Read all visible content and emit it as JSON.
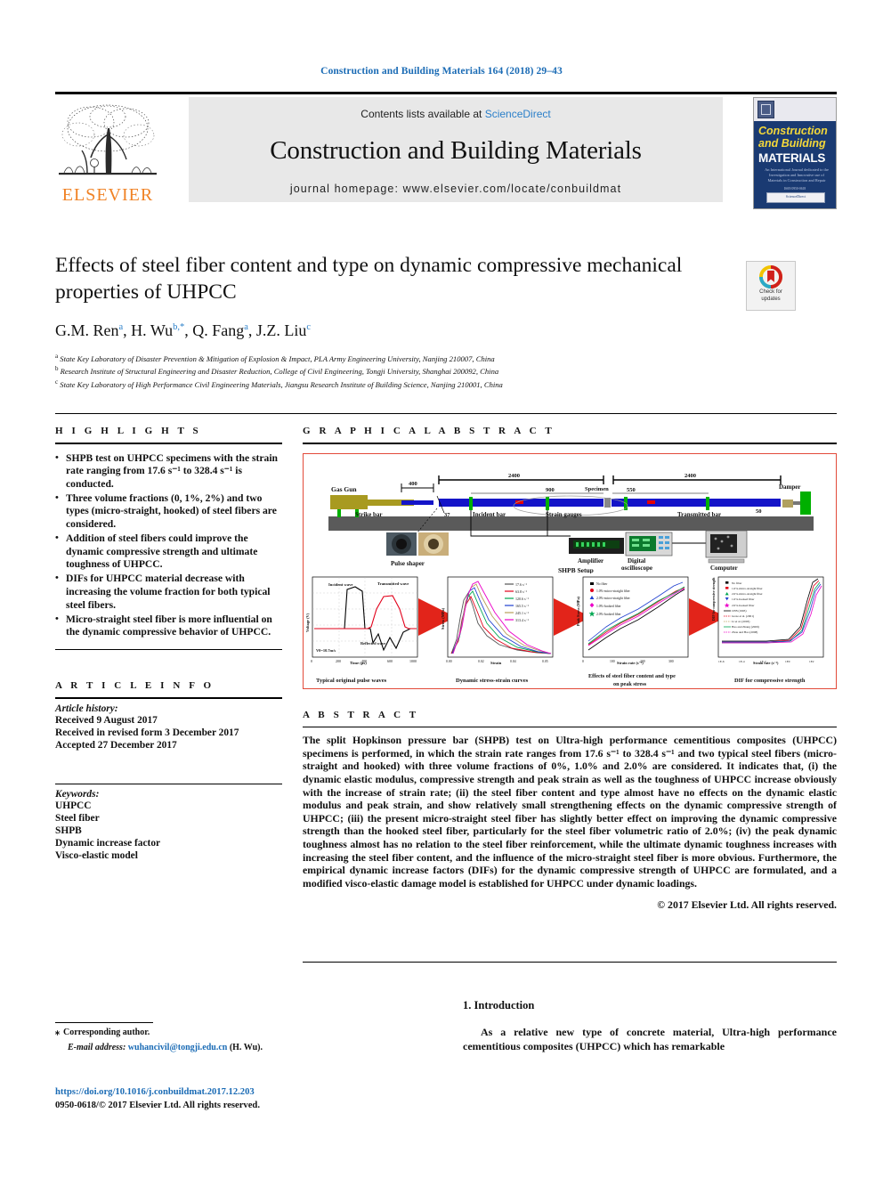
{
  "running_head": "Construction and Building Materials 164 (2018) 29–43",
  "masthead": {
    "contents_prefix": "Contents lists available at ",
    "sciencedirect": "ScienceDirect",
    "journal_title": "Construction and Building Materials",
    "homepage": "journal homepage: www.elsevier.com/locate/conbuildmat",
    "publisher_logo_text": "ELSEVIER",
    "cover": {
      "line1": "Construction",
      "line2": "and Building",
      "line3": "MATERIALS",
      "subtitle": "An International Journal dedicated to the Investigation and Innovative use of Materials in Construction and Repair",
      "footer_badge": "ScienceDirect",
      "issn_note": "ISSN 0950-0618"
    }
  },
  "title_block": {
    "title": "Effects of steel fiber content and type on dynamic compressive mechanical properties of UHPCC",
    "authors": [
      {
        "name": "G.M. Ren",
        "sup": "a"
      },
      {
        "name": "H. Wu",
        "sup": "b,*"
      },
      {
        "name": "Q. Fang",
        "sup": "a"
      },
      {
        "name": "J.Z. Liu",
        "sup": "c"
      }
    ],
    "affiliations": [
      {
        "marker": "a",
        "text": "State Key Laboratory of Disaster Prevention & Mitigation of Explosion & Impact, PLA Army Engineering University, Nanjing 210007, China"
      },
      {
        "marker": "b",
        "text": "Research Institute of Structural Engineering and Disaster Reduction, College of Civil Engineering, Tongji University, Shanghai 200092, China"
      },
      {
        "marker": "c",
        "text": "State Key Laboratory of High Performance Civil Engineering Materials, Jiangsu Research Institute of Building Science, Nanjing 210001, China"
      }
    ],
    "crossmark": {
      "line1": "Check for",
      "line2": "updates"
    }
  },
  "highlights": {
    "heading": "H I G H L I G H T S",
    "items": [
      "SHPB test on UHPCC specimens with the strain rate ranging from 17.6 s⁻¹ to 328.4 s⁻¹ is conducted.",
      "Three volume fractions (0, 1%, 2%) and two types (micro-straight, hooked) of steel fibers are considered.",
      "Addition of steel fibers could improve the dynamic compressive strength and ultimate toughness of UHPCC.",
      "DIFs for UHPCC material decrease with increasing the volume fraction for both typical steel fibers.",
      "Micro-straight steel fiber is more influential on the dynamic compressive behavior of UHPCC."
    ]
  },
  "article_info": {
    "heading": "A R T I C L E   I N F O",
    "history_label": "Article history:",
    "history": [
      "Received 9 August 2017",
      "Received in revised form 3 December 2017",
      "Accepted 27 December 2017"
    ],
    "keywords_label": "Keywords:",
    "keywords": [
      "UHPCC",
      "Steel fiber",
      "SHPB",
      "Dynamic increase factor",
      "Visco-elastic model"
    ]
  },
  "graphical_abstract": {
    "heading": "G R A P H I C A L   A B S T R A C T",
    "setup": {
      "caption": "SHPB Setup",
      "labels": {
        "gas_gun": "Gas Gun",
        "strike_bar": "Strike bar",
        "incident_bar": "Incident bar",
        "strain_gauges": "Strain gauges",
        "transmitted_bar": "Transmitted bar",
        "specimen": "Specimen",
        "damper": "Damper",
        "pulse_shaper": "Pulse shaper",
        "amplifier": "Amplifier",
        "oscilloscope": "Digital oscilloscope",
        "computer": "Computer"
      },
      "dimensions": {
        "strike_bar_len": "400",
        "incident_bar_len": "2400",
        "transmitted_bar_len": "2400",
        "gauge_to_specimen_left": "900",
        "gauge_to_specimen_right": "550",
        "bar_diameter": "37",
        "damper_dim": "50"
      }
    },
    "panels": [
      {
        "caption": "Typical original pulse waves",
        "chart_ref": 0
      },
      {
        "caption": "Dynamic stress-strain curves",
        "chart_ref": 1
      },
      {
        "caption": "Effects of steel fiber content and type on peak stress",
        "chart_ref": 2
      },
      {
        "caption": "DIF for compressive strength",
        "chart_ref": 3
      }
    ]
  },
  "chart_data": [
    {
      "type": "line",
      "title": "Typical original pulse waves",
      "xlabel": "Time (μs)",
      "ylabel": "Voltage (V)",
      "xlim": [
        0,
        1000
      ],
      "ylim": [
        -0.8,
        2.0
      ],
      "xticks": [
        0,
        200,
        400,
        600,
        800,
        1000
      ],
      "yticks": [
        -0.8,
        -0.4,
        0.0,
        0.4,
        0.8,
        1.2,
        1.6,
        2.0
      ],
      "annotation": "V0 = 10.7 m/s",
      "series": [
        {
          "name": "Incident wave",
          "color": "#000000"
        },
        {
          "name": "Transmitted wave",
          "color": "#e2001a"
        },
        {
          "name": "Reflected wave",
          "color": "#000000"
        }
      ]
    },
    {
      "type": "line",
      "title": "Dynamic stress-strain curves",
      "xlabel": "Strain",
      "ylabel": "Stress (MPa)",
      "xlim": [
        0.0,
        0.05
      ],
      "ylim": [
        0,
        250
      ],
      "xticks": [
        0.0,
        0.01,
        0.02,
        0.03,
        0.04,
        0.05
      ],
      "yticks": [
        0,
        50,
        100,
        150,
        200,
        250
      ],
      "legend_position": "top-right",
      "series": [
        {
          "name": "17.6 s⁻¹",
          "color": "#555555"
        },
        {
          "name": "63.8 s⁻¹",
          "color": "#e2001a"
        },
        {
          "name": "120.6 s⁻¹",
          "color": "#00a651"
        },
        {
          "name": "165.5 s⁻¹",
          "color": "#1f3fd0"
        },
        {
          "name": "245.1 s⁻¹",
          "color": "#b8a05a"
        },
        {
          "name": "313.4 s⁻¹",
          "color": "#ec00c8"
        }
      ]
    },
    {
      "type": "scatter",
      "title": "Effects of steel fiber content and type on peak stress",
      "xlabel": "Strain rate (s⁻¹)",
      "ylabel": "Peak Stress (MPa)",
      "xlim": [
        0,
        350
      ],
      "ylim": [
        100,
        280
      ],
      "xticks": [
        0,
        50,
        100,
        150,
        200,
        250,
        300,
        350
      ],
      "yticks": [
        100,
        120,
        140,
        160,
        180,
        200,
        220,
        240,
        260,
        280
      ],
      "legend_position": "top-left",
      "series": [
        {
          "name": "No fiber",
          "color": "#000000",
          "marker": "square"
        },
        {
          "name": "1.0%-micro-straight fiber",
          "color": "#e2001a",
          "marker": "circle"
        },
        {
          "name": "2.0%-micro-straight fiber",
          "color": "#1f3fd0",
          "marker": "triangle"
        },
        {
          "name": "1.0%-hooked fiber",
          "color": "#ec00c8",
          "marker": "diamond"
        },
        {
          "name": "2.0%-hooked fiber",
          "color": "#00a651",
          "marker": "star"
        }
      ]
    },
    {
      "type": "scatter",
      "title": "DIF for compressive strength",
      "xlabel": "Strain rate (s⁻¹)",
      "ylabel": "DIF for compressive strength",
      "xlim": [
        1e-06,
        1000
      ],
      "ylim": [
        0.5,
        2.5
      ],
      "xticks": [
        "1E-6",
        "1E-5",
        "1E-4",
        "1E-3",
        "1E-2",
        "1E-1",
        "1E0",
        "1E1",
        "1E2",
        "1E3"
      ],
      "yticks": [
        0.5,
        1.0,
        1.5,
        2.0,
        2.5
      ],
      "legend_position": "top-left",
      "series": [
        {
          "name": "No fiber",
          "color": "#000000",
          "marker": "square"
        },
        {
          "name": "1.0%-micro-straight fiber",
          "color": "#e2001a",
          "marker": "square"
        },
        {
          "name": "2.0%-micro-straight fiber",
          "color": "#00a651",
          "marker": "triangle"
        },
        {
          "name": "1.0%-hooked fiber",
          "color": "#1f3fd0",
          "marker": "triangle-down"
        },
        {
          "name": "2.0%-hooked fiber",
          "color": "#ec00c8",
          "marker": "star"
        },
        {
          "name": "CEB (1993)",
          "color": "#000000",
          "marker": "line"
        },
        {
          "name": "Grote et al. (2001)",
          "color": "#e2001a",
          "marker": "line"
        },
        {
          "name": "Li et al. (2003)",
          "color": "#b8a05a",
          "marker": "line"
        },
        {
          "name": "Hao and Zhang (2009)",
          "color": "#00a651",
          "marker": "line"
        },
        {
          "name": "Zhou and Hao (2008)",
          "color": "#ec00c8",
          "marker": "line"
        }
      ]
    }
  ],
  "abstract": {
    "heading": "A B S T R A C T",
    "text": "The split Hopkinson pressure bar (SHPB) test on Ultra-high performance cementitious composites (UHPCC) specimens is performed, in which the strain rate ranges from 17.6 s⁻¹ to 328.4 s⁻¹ and two typical steel fibers (micro-straight and hooked) with three volume fractions of 0%, 1.0% and 2.0% are considered. It indicates that, (i) the dynamic elastic modulus, compressive strength and peak strain as well as the toughness of UHPCC increase obviously with the increase of strain rate; (ii) the steel fiber content and type almost have no effects on the dynamic elastic modulus and peak strain, and show relatively small strengthening effects on the dynamic compressive strength of UHPCC; (iii) the present micro-straight steel fiber has slightly better effect on improving the dynamic compressive strength than the hooked steel fiber, particularly for the steel fiber volumetric ratio of 2.0%; (iv) the peak dynamic toughness almost has no relation to the steel fiber reinforcement, while the ultimate dynamic toughness increases with increasing the steel fiber content, and the influence of the micro-straight steel fiber is more obvious. Furthermore, the empirical dynamic increase factors (DIFs) for the dynamic compressive strength of UHPCC are formulated, and a modified visco-elastic damage model is established for UHPCC under dynamic loadings.",
    "copyright": "© 2017 Elsevier Ltd. All rights reserved."
  },
  "introduction": {
    "heading": "1. Introduction",
    "paragraph": "As a relative new type of concrete material, Ultra-high performance cementitious composites (UHPCC) which has remarkable"
  },
  "footer": {
    "corresponding_marker": "⁎",
    "corresponding_label": "Corresponding author.",
    "email_label": "E-mail address:",
    "email": "wuhancivil@tongji.edu.cn",
    "email_suffix": "(H. Wu).",
    "doi": "https://doi.org/10.1016/j.conbuildmat.2017.12.203",
    "issn_copyright": "0950-0618/© 2017 Elsevier Ltd. All rights reserved."
  }
}
